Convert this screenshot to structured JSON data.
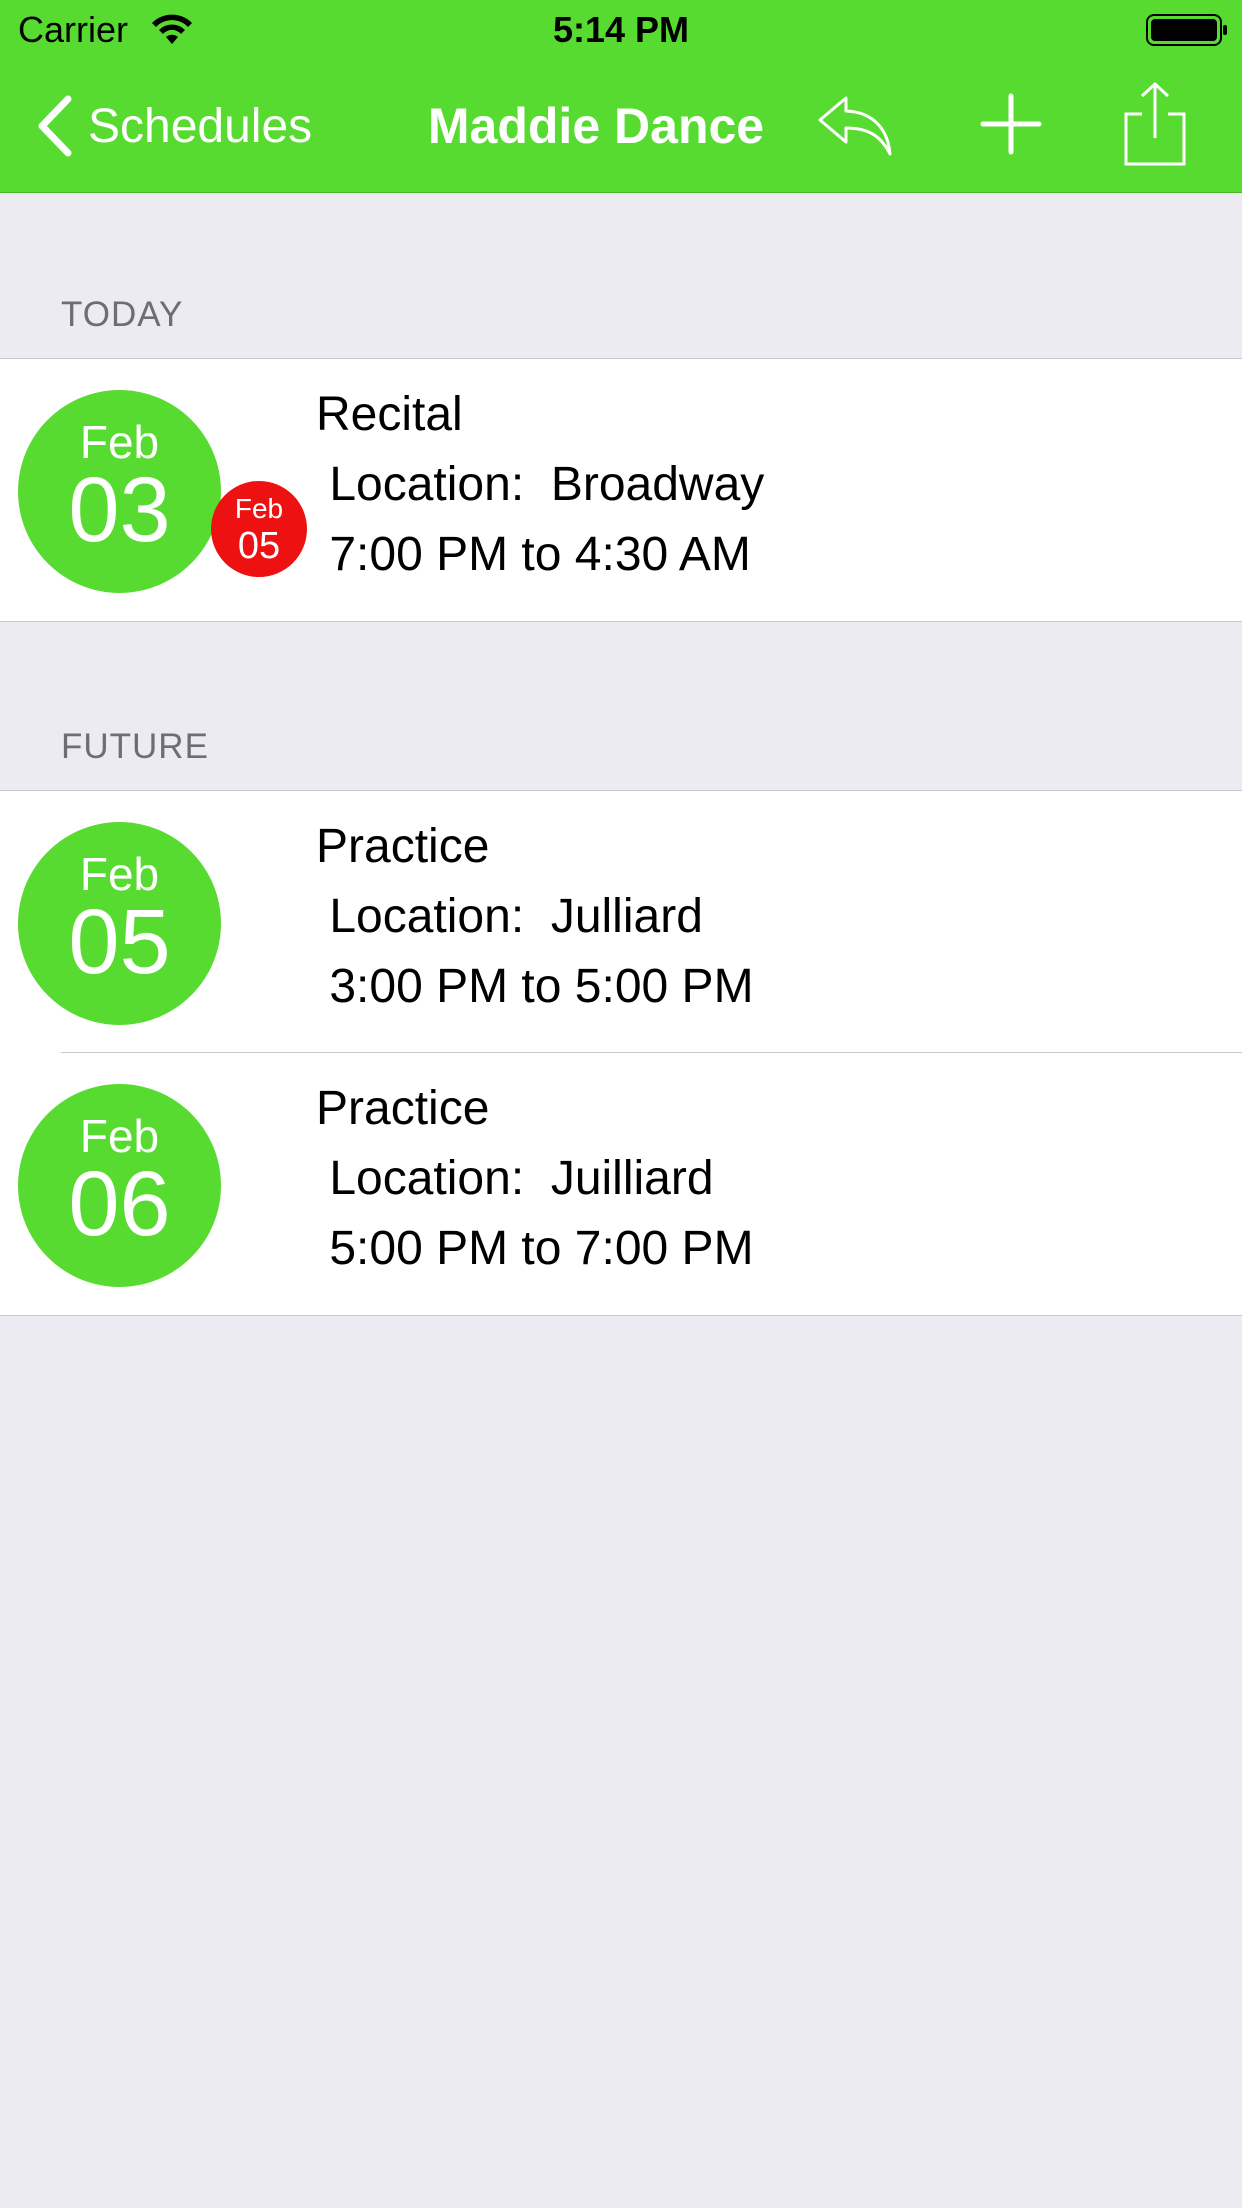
{
  "status_bar": {
    "carrier": "Carrier",
    "time": "5:14 PM"
  },
  "nav_bar": {
    "back_label": "Schedules",
    "title": "Maddie Dance",
    "icons": [
      "reply-icon",
      "add-icon",
      "share-icon"
    ],
    "color": "#57db30"
  },
  "sections": [
    {
      "header": "TODAY",
      "events": [
        {
          "title": "Recital",
          "location": " Location:  Broadway",
          "time": " 7:00 PM to 4:30 AM",
          "start_month": "Feb",
          "start_day": "03",
          "end_month": "Feb",
          "end_day": "05"
        }
      ]
    },
    {
      "header": "FUTURE",
      "events": [
        {
          "title": "Practice",
          "location": " Location:  Julliard",
          "time": " 3:00 PM to 5:00 PM",
          "start_month": "Feb",
          "start_day": "05"
        },
        {
          "title": "Practice",
          "location": " Location:  Juilliard",
          "time": " 5:00 PM to 7:00 PM",
          "start_month": "Feb",
          "start_day": "06"
        }
      ]
    }
  ],
  "colors": {
    "accent_green": "#57db30",
    "end_date_red": "#ee1111",
    "background": "#ebebf1"
  }
}
